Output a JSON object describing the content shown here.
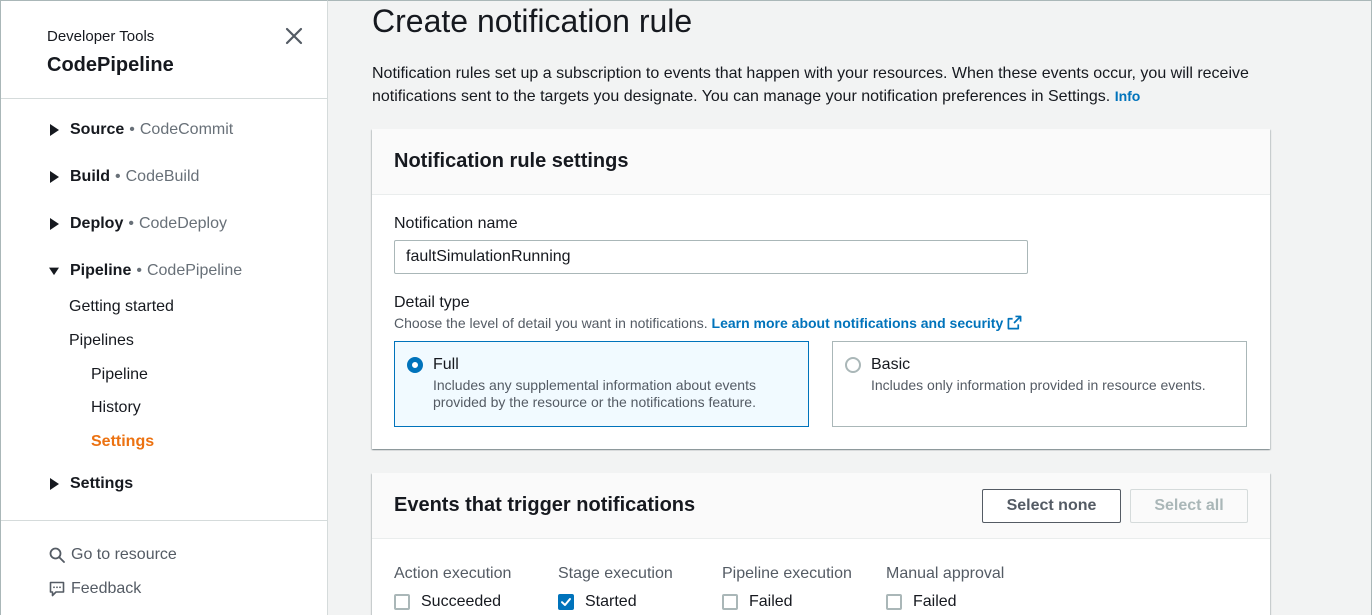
{
  "sidebar": {
    "subtitle": "Developer Tools",
    "title": "CodePipeline",
    "sections": [
      {
        "name": "Source",
        "service": "CodeCommit"
      },
      {
        "name": "Build",
        "service": "CodeBuild"
      },
      {
        "name": "Deploy",
        "service": "CodeDeploy"
      },
      {
        "name": "Pipeline",
        "service": "CodePipeline"
      }
    ],
    "dot": "•",
    "pipeline_links": [
      "Getting started",
      "Pipelines"
    ],
    "pipeline_sublinks": [
      "Pipeline",
      "History",
      "Settings"
    ],
    "settings": "Settings",
    "footer": {
      "go_to_resource": "Go to resource",
      "feedback": "Feedback"
    },
    "active_color": "#ec7211"
  },
  "main": {
    "title": "Create notification rule",
    "description": "Notification rules set up a subscription to events that happen with your resources. When these events occur, you will receive notifications sent to the targets you designate. You can manage your notification preferences in Settings.",
    "info": "Info",
    "settings_card": {
      "title": "Notification rule settings",
      "name_label": "Notification name",
      "name_value": "faultSimulationRunning",
      "detail_label": "Detail type",
      "detail_desc": "Choose the level of detail you want in notifications.",
      "learn_more": "Learn more about notifications and security",
      "options": [
        {
          "title": "Full",
          "desc": "Includes any supplemental information about events provided by the resource or the notifications feature.",
          "selected": true
        },
        {
          "title": "Basic",
          "desc": "Includes only information provided in resource events.",
          "selected": false
        }
      ]
    },
    "events_card": {
      "title": "Events that trigger notifications",
      "select_none": "Select none",
      "select_all": "Select all",
      "columns": [
        {
          "heading": "Action execution",
          "first_item": "Succeeded",
          "checked": false
        },
        {
          "heading": "Stage execution",
          "first_item": "Started",
          "checked": true
        },
        {
          "heading": "Pipeline execution",
          "first_item": "Failed",
          "checked": false
        },
        {
          "heading": "Manual approval",
          "first_item": "Failed",
          "checked": false
        }
      ]
    },
    "link_color": "#0073bb"
  }
}
